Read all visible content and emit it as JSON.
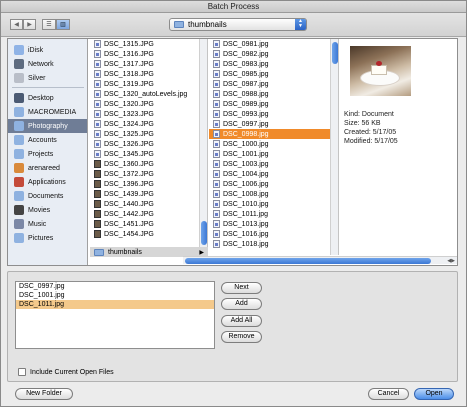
{
  "window": {
    "title": "Batch Process"
  },
  "toolbar": {
    "path_label": "thumbnails"
  },
  "sidebar": {
    "items": [
      {
        "label": "iDisk",
        "icon": "idisk-icon",
        "color": "#8fb3e6"
      },
      {
        "label": "Network",
        "icon": "network-icon",
        "color": "#5d6b7f"
      },
      {
        "label": "Silver",
        "icon": "drive-icon",
        "color": "#b9bec8"
      },
      {
        "label": "Desktop",
        "icon": "desktop-icon",
        "color": "#4b5a73"
      },
      {
        "label": "MACROMEDIA",
        "icon": "folder-icon",
        "color": "#8fb2e0"
      },
      {
        "label": "Photography",
        "icon": "folder-icon",
        "color": "#8fb2e0"
      },
      {
        "label": "Accounts",
        "icon": "folder-icon",
        "color": "#8fb2e0"
      },
      {
        "label": "Projects",
        "icon": "folder-icon",
        "color": "#8fb2e0"
      },
      {
        "label": "arenareed",
        "icon": "home-icon",
        "color": "#d98a3b"
      },
      {
        "label": "Applications",
        "icon": "applications-icon",
        "color": "#c44b3a"
      },
      {
        "label": "Documents",
        "icon": "documents-icon",
        "color": "#8fb2e0"
      },
      {
        "label": "Movies",
        "icon": "movies-icon",
        "color": "#444"
      },
      {
        "label": "Music",
        "icon": "music-icon",
        "color": "#7b88a6"
      },
      {
        "label": "Pictures",
        "icon": "pictures-icon",
        "color": "#8fb2e0"
      }
    ]
  },
  "column1": {
    "items": [
      "DSC_1315.JPG",
      "DSC_1316.JPG",
      "DSC_1317.JPG",
      "DSC_1318.JPG",
      "DSC_1319.JPG",
      "DSC_1320_autoLevels.jpg",
      "DSC_1320.JPG",
      "DSC_1323.JPG",
      "DSC_1324.JPG",
      "DSC_1325.JPG",
      "DSC_1326.JPG",
      "DSC_1345.JPG",
      "DSC_1360.JPG",
      "DSC_1372.JPG",
      "DSC_1396.JPG",
      "DSC_1439.JPG",
      "DSC_1440.JPG",
      "DSC_1442.JPG",
      "DSC_1451.JPG",
      "DSC_1454.JPG"
    ],
    "folder_row": "thumbnails"
  },
  "column2": {
    "items": [
      "DSC_0981.jpg",
      "DSC_0982.jpg",
      "DSC_0983.jpg",
      "DSC_0985.jpg",
      "DSC_0987.jpg",
      "DSC_0988.jpg",
      "DSC_0989.jpg",
      "DSC_0993.jpg",
      "DSC_0997.jpg",
      "DSC_0998.jpg",
      "DSC_1000.jpg",
      "DSC_1001.jpg",
      "DSC_1003.jpg",
      "DSC_1004.jpg",
      "DSC_1006.jpg",
      "DSC_1008.jpg",
      "DSC_1010.jpg",
      "DSC_1011.jpg",
      "DSC_1013.jpg",
      "DSC_1016.jpg",
      "DSC_1018.jpg"
    ],
    "selected_index": 9
  },
  "preview": {
    "kind": "Kind: Document",
    "size": "Size: 56 KB",
    "created": "Created: 5/17/05",
    "modified": "Modified: 5/17/05"
  },
  "file_list": {
    "items": [
      "DSC_0997.jpg",
      "DSC_1001.jpg",
      "DSC_1011.jpg"
    ],
    "selected_index": 2
  },
  "actions": {
    "next": "Next",
    "add": "Add",
    "add_all": "Add All",
    "remove": "Remove"
  },
  "checkbox": {
    "label": "Include Current Open Files"
  },
  "footer": {
    "new_folder": "New Folder",
    "cancel": "Cancel",
    "open": "Open"
  },
  "colors": {
    "selection": "#f08a2a",
    "sidebar_selection": "#6f7d96",
    "list_selection": "#f4c98b",
    "accent": "#3c78d5"
  }
}
